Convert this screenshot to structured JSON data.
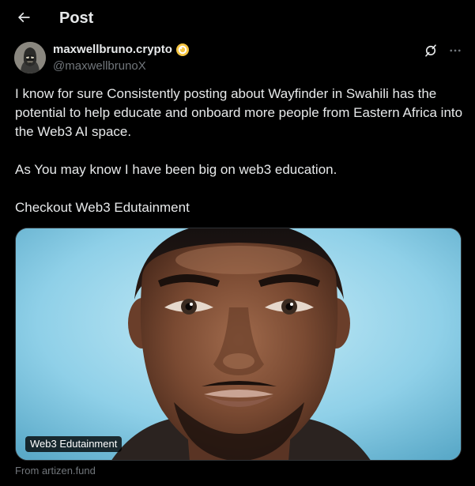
{
  "header": {
    "title": "Post",
    "back_icon": "arrow-left-icon"
  },
  "author": {
    "display_name": "maxwellbruno.crypto",
    "handle": "@maxwellbrunoX",
    "badge_icon": "verified-gold-badge-icon"
  },
  "actions": {
    "grok_icon": "grok-icon",
    "more_icon": "more-horizontal-icon"
  },
  "tweet": {
    "paragraphs": [
      "I know for sure Consistently posting about Wayfinder in Swahili has the potential to help educate and onboard more people from Eastern Africa into the Web3 AI space.",
      "As You may know I have been big on web3 education.",
      "Checkout Web3 Edutainment"
    ]
  },
  "card": {
    "label": "Web3 Edutainment",
    "source": "From artizen.fund"
  },
  "colors": {
    "background": "#000000",
    "text_primary": "#e7e9ea",
    "text_secondary": "#71767b",
    "badge_gold": "#f5c542"
  }
}
